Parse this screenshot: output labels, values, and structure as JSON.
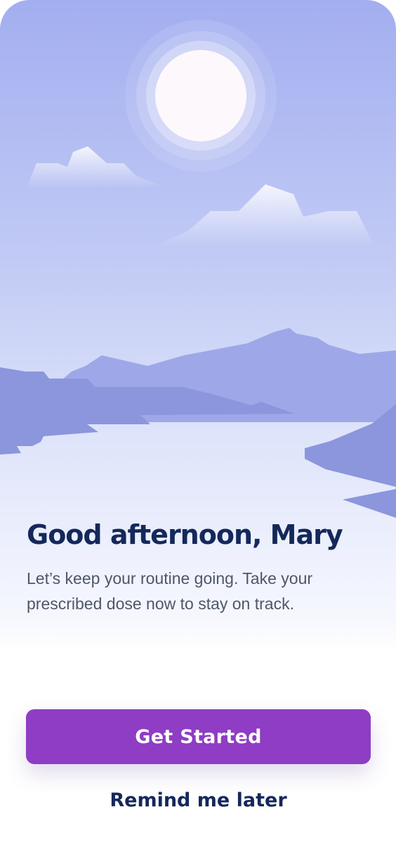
{
  "onboarding": {
    "greeting": "Good afternoon, Mary",
    "message": "Let’s keep your routine going. Take your prescribed dose now to stay on track.",
    "primary_label": "Get Started",
    "secondary_label": "Remind me later"
  },
  "colors": {
    "sky_top": "#a3aef0",
    "mountain": "#9ea8e8",
    "shore": "#8c96dc",
    "title_text": "#14285a",
    "body_text": "#4f5767",
    "primary_button": "#8e3dc4",
    "primary_button_text": "#ffffff"
  }
}
